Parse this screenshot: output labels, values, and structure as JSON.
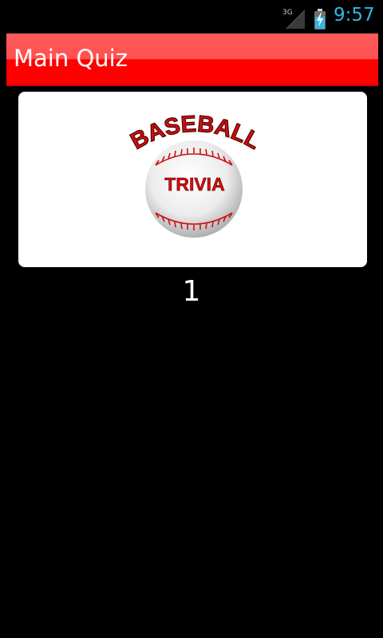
{
  "status_bar": {
    "network_label": "3G",
    "time": "9:57",
    "time_color": "#33b5e5",
    "icons": [
      "signal-icon",
      "battery-charging-icon"
    ]
  },
  "action_bar": {
    "title": "Main Quiz",
    "color": "#ff0000"
  },
  "logo": {
    "top_text": "BASEBALL",
    "ball_text": "TRIVIA",
    "text_color": "#cc1111",
    "icon": "baseball-icon"
  },
  "question_number": "1"
}
